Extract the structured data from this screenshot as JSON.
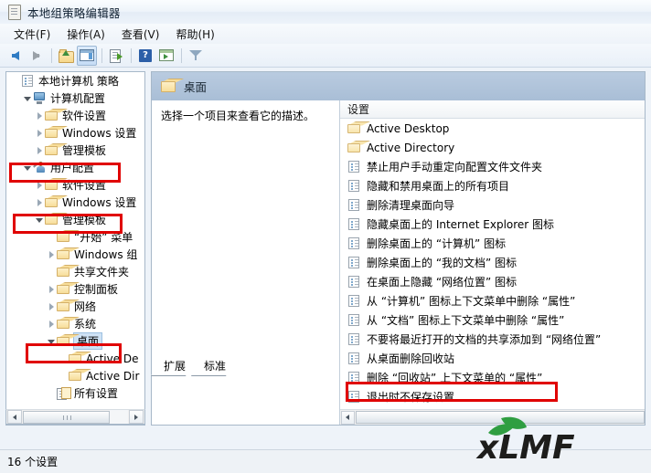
{
  "window": {
    "title": "本地组策略编辑器",
    "icon": "document-icon"
  },
  "menubar": {
    "items": [
      {
        "label": "文件(F)",
        "name": "menu-file"
      },
      {
        "label": "操作(A)",
        "name": "menu-action"
      },
      {
        "label": "查看(V)",
        "name": "menu-view"
      },
      {
        "label": "帮助(H)",
        "name": "menu-help"
      }
    ]
  },
  "toolbar": {
    "buttons": [
      {
        "name": "back-button",
        "icon": "arrow-left-icon",
        "tooltip": "后退"
      },
      {
        "name": "forward-button",
        "icon": "arrow-right-icon",
        "tooltip": "前进"
      },
      {
        "name": "up-one-level-button",
        "icon": "folder-up-icon",
        "tooltip": "上一级"
      },
      {
        "name": "show-hide-tree-button",
        "icon": "show-pane-icon",
        "tooltip": "显示/隐藏控制台树",
        "pressed": true
      },
      {
        "name": "export-list-button",
        "icon": "export-list-icon",
        "tooltip": "导出列表"
      },
      {
        "name": "help-button",
        "icon": "help-icon",
        "tooltip": "帮助"
      },
      {
        "name": "show-pane-button",
        "icon": "show-detail-icon",
        "tooltip": "显示窗格"
      },
      {
        "name": "filter-button",
        "icon": "filter-icon",
        "tooltip": "筛选"
      }
    ]
  },
  "tree": {
    "nodes": [
      {
        "label": "本地计算机 策略",
        "icon": "policy-doc-icon",
        "indent": 0,
        "twist": "none",
        "name": "tree-local-computer-policy"
      },
      {
        "label": "计算机配置",
        "icon": "computer-icon",
        "indent": 1,
        "twist": "expanded",
        "name": "tree-computer-configuration"
      },
      {
        "label": "软件设置",
        "icon": "folder-icon",
        "indent": 2,
        "twist": "collapsed",
        "name": "tree-computer-software-settings"
      },
      {
        "label": "Windows 设置",
        "icon": "folder-icon",
        "indent": 2,
        "twist": "collapsed",
        "name": "tree-computer-windows-settings"
      },
      {
        "label": "管理模板",
        "icon": "folder-icon",
        "indent": 2,
        "twist": "collapsed",
        "name": "tree-computer-admin-templates"
      },
      {
        "label": "用户配置",
        "icon": "user-config-icon",
        "indent": 1,
        "twist": "expanded",
        "name": "tree-user-configuration",
        "highlighted": true
      },
      {
        "label": "软件设置",
        "icon": "folder-icon",
        "indent": 2,
        "twist": "collapsed",
        "name": "tree-user-software-settings"
      },
      {
        "label": "Windows 设置",
        "icon": "folder-icon",
        "indent": 2,
        "twist": "collapsed",
        "name": "tree-user-windows-settings"
      },
      {
        "label": "管理模板",
        "icon": "folder-icon",
        "indent": 2,
        "twist": "expanded",
        "name": "tree-user-admin-templates",
        "highlighted": true
      },
      {
        "label": "“开始” 菜单",
        "icon": "folder-icon",
        "indent": 3,
        "twist": "none",
        "name": "tree-start-menu"
      },
      {
        "label": "Windows 组",
        "icon": "folder-icon",
        "indent": 3,
        "twist": "collapsed",
        "name": "tree-windows-components"
      },
      {
        "label": "共享文件夹",
        "icon": "folder-icon",
        "indent": 3,
        "twist": "none",
        "name": "tree-shared-folders"
      },
      {
        "label": "控制面板",
        "icon": "folder-icon",
        "indent": 3,
        "twist": "collapsed",
        "name": "tree-control-panel"
      },
      {
        "label": "网络",
        "icon": "folder-icon",
        "indent": 3,
        "twist": "collapsed",
        "name": "tree-network"
      },
      {
        "label": "系统",
        "icon": "folder-icon",
        "indent": 3,
        "twist": "collapsed",
        "name": "tree-system"
      },
      {
        "label": "桌面",
        "icon": "folder-icon",
        "indent": 3,
        "twist": "expanded",
        "name": "tree-desktop",
        "selected": true,
        "highlighted": true
      },
      {
        "label": "Active De",
        "icon": "folder-icon",
        "indent": 4,
        "twist": "none",
        "name": "tree-active-desktop"
      },
      {
        "label": "Active Dir",
        "icon": "folder-icon",
        "indent": 4,
        "twist": "none",
        "name": "tree-active-directory"
      },
      {
        "label": "所有设置",
        "icon": "all-settings-icon",
        "indent": 3,
        "twist": "none",
        "name": "tree-all-settings"
      }
    ]
  },
  "content": {
    "header_title": "桌面",
    "header_icon": "folder-icon",
    "description": "选择一个项目来查看它的描述。",
    "list_column_header": "设置",
    "items": [
      {
        "label": "Active Desktop",
        "icon": "folder-icon",
        "name": "list-item-active-desktop"
      },
      {
        "label": "Active Directory",
        "icon": "folder-icon",
        "name": "list-item-active-directory"
      },
      {
        "label": "禁止用户手动重定向配置文件文件夹",
        "icon": "policy-icon",
        "name": "list-item-prevent-redirect-profile-folders"
      },
      {
        "label": "隐藏和禁用桌面上的所有项目",
        "icon": "policy-icon",
        "name": "list-item-hide-disable-all-desktop-items"
      },
      {
        "label": "删除清理桌面向导",
        "icon": "policy-icon",
        "name": "list-item-remove-desktop-cleanup-wizard"
      },
      {
        "label": "隐藏桌面上的 Internet Explorer 图标",
        "icon": "policy-icon",
        "name": "list-item-hide-ie-icon"
      },
      {
        "label": "删除桌面上的 “计算机” 图标",
        "icon": "policy-icon",
        "name": "list-item-remove-computer-icon"
      },
      {
        "label": "删除桌面上的 “我的文档” 图标",
        "icon": "policy-icon",
        "name": "list-item-remove-my-documents-icon"
      },
      {
        "label": "在桌面上隐藏 “网络位置” 图标",
        "icon": "policy-icon",
        "name": "list-item-hide-network-locations-icon"
      },
      {
        "label": "从 “计算机” 图标上下文菜单中删除 “属性”",
        "icon": "policy-icon",
        "name": "list-item-remove-properties-computer-context-menu"
      },
      {
        "label": "从 “文档” 图标上下文菜单中删除 “属性”",
        "icon": "policy-icon",
        "name": "list-item-remove-properties-documents-context-menu"
      },
      {
        "label": "不要将最近打开的文档的共享添加到 “网络位置”",
        "icon": "policy-icon",
        "name": "list-item-no-recent-docs-network-locations"
      },
      {
        "label": "从桌面删除回收站",
        "icon": "policy-icon",
        "name": "list-item-remove-recycle-bin-desktop"
      },
      {
        "label": "删除 “回收站” 上下文菜单的 “属性”",
        "icon": "policy-icon",
        "name": "list-item-remove-recycle-bin-properties",
        "highlighted": true
      },
      {
        "label": "退出时不保存设置",
        "icon": "policy-icon",
        "name": "list-item-dont-save-settings-at-exit"
      }
    ]
  },
  "tabs": {
    "items": [
      {
        "label": "扩展",
        "name": "tab-extended",
        "active": false
      },
      {
        "label": "标准",
        "name": "tab-standard",
        "active": true
      }
    ]
  },
  "statusbar": {
    "text": "16 个设置"
  },
  "watermark": {
    "text": "xLMF",
    "leaf_color": "#2f9e41",
    "text_color": "#1d1d1b"
  },
  "colors": {
    "annotation": "#e00000",
    "selection": "#cfe2f5",
    "header_bar": "#a9bed6"
  }
}
